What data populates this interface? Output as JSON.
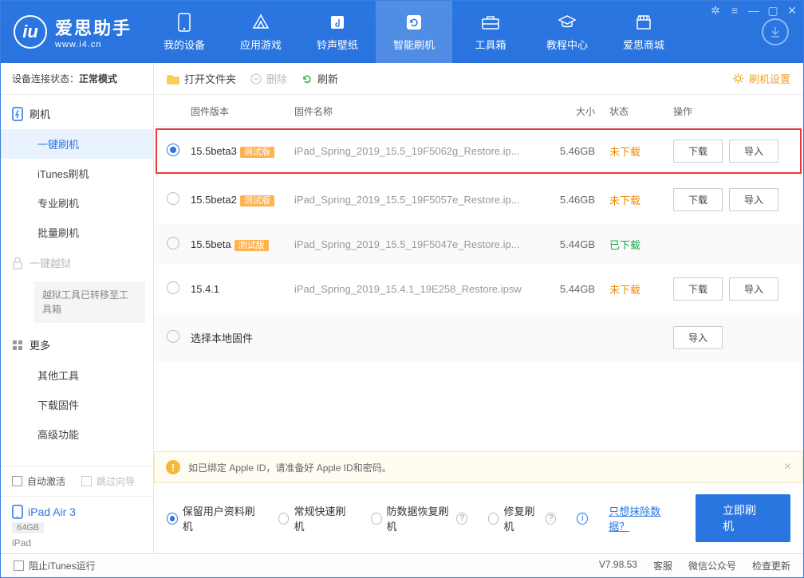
{
  "brand": {
    "name": "爱思助手",
    "site": "www.i4.cn",
    "logo_letter": "iu"
  },
  "topnav": [
    {
      "label": "我的设备"
    },
    {
      "label": "应用游戏"
    },
    {
      "label": "铃声壁纸"
    },
    {
      "label": "智能刷机"
    },
    {
      "label": "工具箱"
    },
    {
      "label": "教程中心"
    },
    {
      "label": "爱思商城"
    }
  ],
  "conn": {
    "prefix": "设备连接状态：",
    "mode": "正常模式"
  },
  "sidebar": {
    "flash": {
      "head": "刷机",
      "items": [
        "一键刷机",
        "iTunes刷机",
        "专业刷机",
        "批量刷机"
      ]
    },
    "jailbreak": {
      "head": "一键越狱",
      "note": "越狱工具已转移至工具箱"
    },
    "more": {
      "head": "更多",
      "items": [
        "其他工具",
        "下载固件",
        "高级功能"
      ]
    }
  },
  "auto": {
    "activate": "自动激活",
    "skip": "跳过向导"
  },
  "device": {
    "name": "iPad Air 3",
    "storage": "64GB",
    "type": "iPad"
  },
  "toolbar": {
    "open": "打开文件夹",
    "delete": "删除",
    "refresh": "刷新",
    "settings": "刷机设置"
  },
  "thead": {
    "ver": "固件版本",
    "name": "固件名称",
    "size": "大小",
    "status": "状态",
    "ops": "操作"
  },
  "rows": [
    {
      "ver": "15.5beta3",
      "beta": "测试版",
      "name": "iPad_Spring_2019_15.5_19F5062g_Restore.ip...",
      "size": "5.46GB",
      "status": "未下载",
      "st_cls": "orange",
      "dl": "下载",
      "imp": "导入",
      "sel": true,
      "alt": false,
      "hl": true
    },
    {
      "ver": "15.5beta2",
      "beta": "测试版",
      "name": "iPad_Spring_2019_15.5_19F5057e_Restore.ip...",
      "size": "5.46GB",
      "status": "未下载",
      "st_cls": "orange",
      "dl": "下载",
      "imp": "导入",
      "sel": false,
      "alt": false
    },
    {
      "ver": "15.5beta",
      "beta": "测试版",
      "name": "iPad_Spring_2019_15.5_19F5047e_Restore.ip...",
      "size": "5.44GB",
      "status": "已下载",
      "st_cls": "green",
      "sel": false,
      "alt": true
    },
    {
      "ver": "15.4.1",
      "name": "iPad_Spring_2019_15.4.1_19E258_Restore.ipsw",
      "size": "5.44GB",
      "status": "未下载",
      "st_cls": "orange",
      "dl": "下载",
      "imp": "导入",
      "sel": false,
      "alt": false
    },
    {
      "ver": "选择本地固件",
      "imp": "导入",
      "sel": false,
      "alt": true
    }
  ],
  "warn": "如已绑定 Apple ID，请准备好 Apple ID和密码。",
  "opts": {
    "keep": "保留用户资料刷机",
    "fast": "常规快速刷机",
    "recover": "防数据恢复刷机",
    "repair": "修复刷机",
    "erase_link": "只想抹除数据？",
    "go": "立即刷机"
  },
  "statusbar": {
    "block_itunes": "阻止iTunes运行",
    "version": "V7.98.53",
    "cs": "客服",
    "wechat": "微信公众号",
    "update": "检查更新"
  }
}
